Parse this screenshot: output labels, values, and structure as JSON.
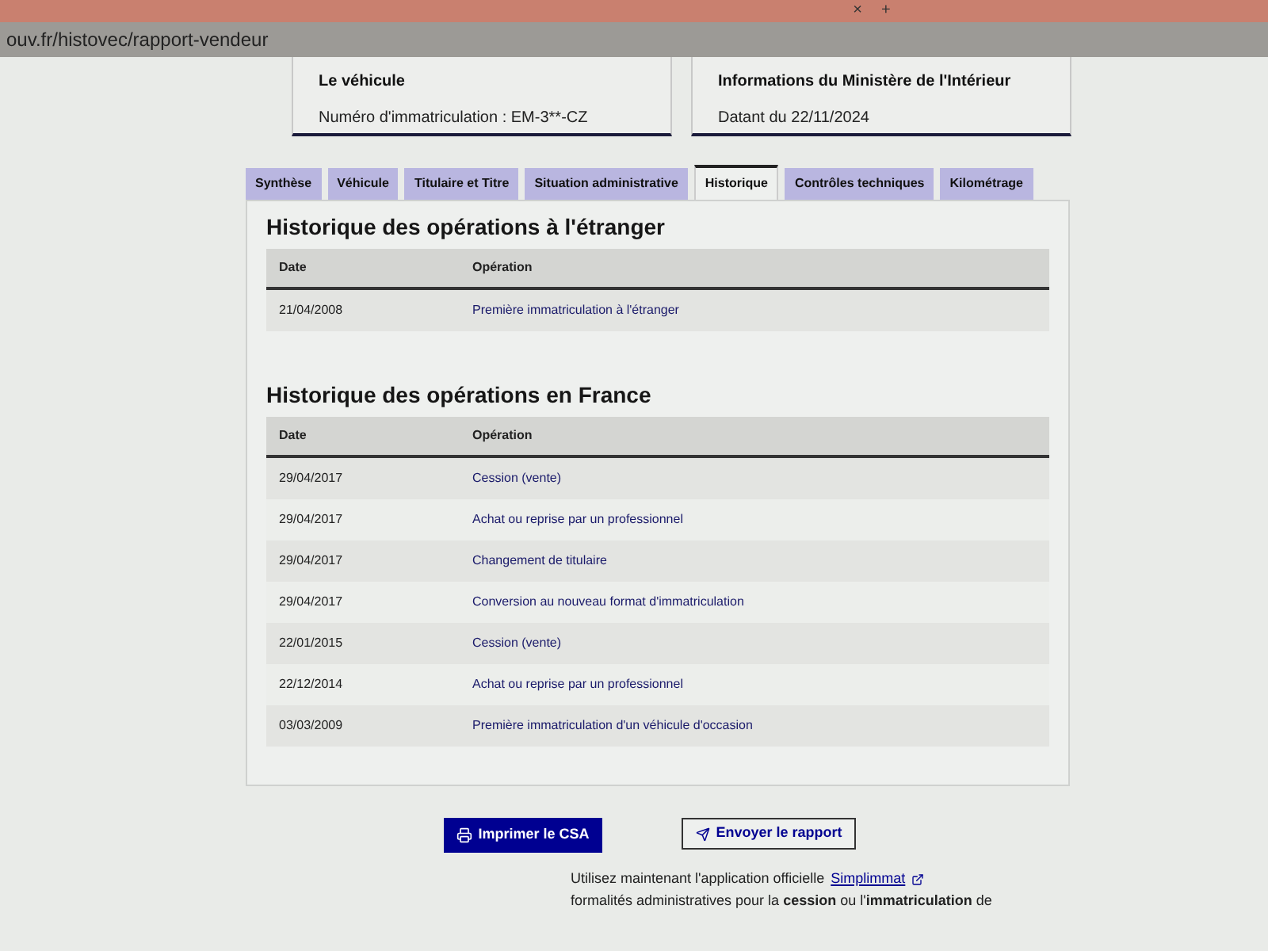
{
  "browser": {
    "tab_controls": [
      "×",
      "+"
    ],
    "url": "ouv.fr/histovec/rapport-vendeur"
  },
  "cards": [
    {
      "title": "Le véhicule",
      "text": "Numéro d'immatriculation : EM-3**-CZ"
    },
    {
      "title": "Informations du Ministère de l'Intérieur",
      "text": "Datant du 22/11/2024"
    }
  ],
  "tabs": [
    {
      "label": "Synthèse",
      "selected": false
    },
    {
      "label": "Véhicule",
      "selected": false
    },
    {
      "label": "Titulaire et Titre",
      "selected": false
    },
    {
      "label": "Situation administrative",
      "selected": false
    },
    {
      "label": "Historique",
      "selected": true
    },
    {
      "label": "Contrôles techniques",
      "selected": false
    },
    {
      "label": "Kilométrage",
      "selected": false
    }
  ],
  "sections": [
    {
      "title": "Historique des opérations à l'étranger",
      "columns": [
        "Date",
        "Opération"
      ],
      "rows": [
        {
          "date": "21/04/2008",
          "operation": "Première immatriculation à l'étranger"
        }
      ]
    },
    {
      "title": "Historique des opérations en France",
      "columns": [
        "Date",
        "Opération"
      ],
      "rows": [
        {
          "date": "29/04/2017",
          "operation": "Cession (vente)"
        },
        {
          "date": "29/04/2017",
          "operation": "Achat ou reprise par un professionnel"
        },
        {
          "date": "29/04/2017",
          "operation": "Changement de titulaire"
        },
        {
          "date": "29/04/2017",
          "operation": "Conversion au nouveau format d'immatriculation"
        },
        {
          "date": "22/01/2015",
          "operation": "Cession (vente)"
        },
        {
          "date": "22/12/2014",
          "operation": "Achat ou reprise par un professionnel"
        },
        {
          "date": "03/03/2009",
          "operation": "Première immatriculation d'un véhicule d'occasion"
        }
      ]
    }
  ],
  "buttons": [
    {
      "label": "Imprimer le CSA",
      "kind": "primary"
    },
    {
      "label": "Envoyer le rapport",
      "kind": "secondary"
    }
  ],
  "footer": {
    "before": "Utilisez maintenant l'application officielle",
    "link": "Simplimmat",
    "after": "formalités administratives pour la **cession** ou l'**immatriculation** de"
  }
}
